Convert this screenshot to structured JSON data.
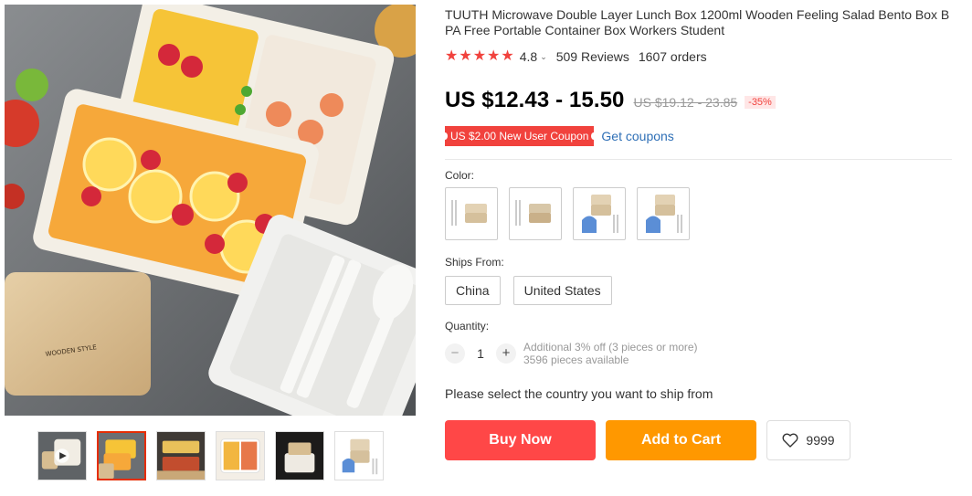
{
  "product": {
    "title": "TUUTH Microwave Double Layer Lunch Box 1200ml Wooden Feeling Salad Bento Box BPA Free Portable Container Box Workers Student",
    "rating": "4.8",
    "star_count": 5,
    "reviews": "509 Reviews",
    "orders": "1607 orders"
  },
  "pricing": {
    "price": "US $12.43 - 15.50",
    "original_price": "US $19.12 - 23.85",
    "discount": "-35%",
    "coupon": "US $2.00 New User Coupon",
    "get_coupons": "Get coupons"
  },
  "color": {
    "label": "Color:",
    "options": [
      "option-1",
      "option-2",
      "option-3",
      "option-4"
    ]
  },
  "ships_from": {
    "label": "Ships From:",
    "options": [
      "China",
      "United States"
    ]
  },
  "quantity": {
    "label": "Quantity:",
    "value": "1",
    "minus": "−",
    "plus": "+",
    "note_line1": "Additional 3% off (3 pieces or more)",
    "note_line2": "3596 pieces available"
  },
  "ship_message": "Please select the country you want to ship from",
  "actions": {
    "buy_now": "Buy Now",
    "add_to_cart": "Add to Cart",
    "wishlist_count": "9999"
  },
  "image": {
    "lid_brand": "WOODEN STYLE"
  },
  "colors": {
    "accent": "#ff4747",
    "cart": "#ff9800",
    "price": "#000000",
    "link": "#2e6fb6"
  }
}
